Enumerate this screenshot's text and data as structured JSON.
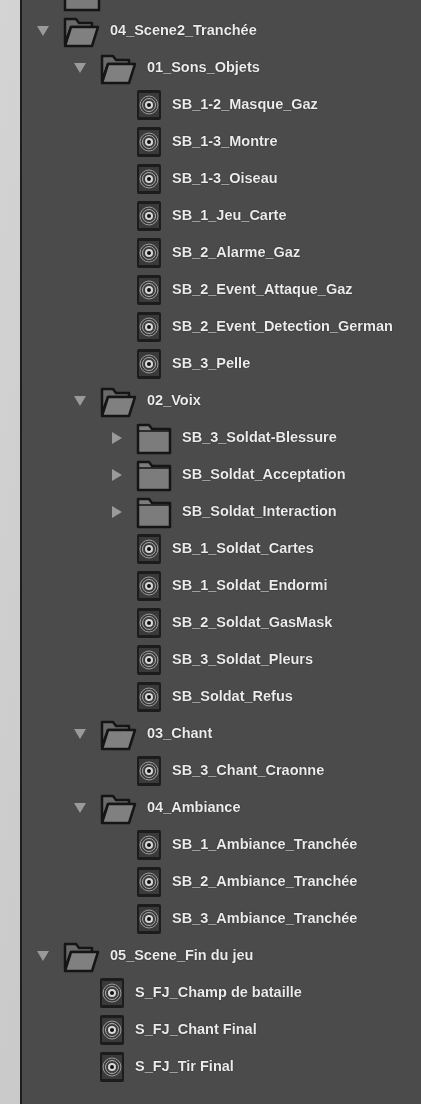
{
  "tree": [
    {
      "kind": "folder",
      "label": "04_Scene2_Tranchée",
      "expanded": true,
      "children": [
        {
          "kind": "folder",
          "label": "01_Sons_Objets",
          "expanded": true,
          "children": [
            {
              "kind": "sound",
              "label": "SB_1-2_Masque_Gaz"
            },
            {
              "kind": "sound",
              "label": "SB_1-3_Montre"
            },
            {
              "kind": "sound",
              "label": "SB_1-3_Oiseau"
            },
            {
              "kind": "sound",
              "label": "SB_1_Jeu_Carte"
            },
            {
              "kind": "sound",
              "label": "SB_2_Alarme_Gaz"
            },
            {
              "kind": "sound",
              "label": "SB_2_Event_Attaque_Gaz"
            },
            {
              "kind": "sound",
              "label": "SB_2_Event_Detection_German"
            },
            {
              "kind": "sound",
              "label": "SB_3_Pelle"
            }
          ]
        },
        {
          "kind": "folder",
          "label": "02_Voix",
          "expanded": true,
          "children": [
            {
              "kind": "folder",
              "label": "SB_3_Soldat-Blessure",
              "expanded": false
            },
            {
              "kind": "folder",
              "label": "SB_Soldat_Acceptation",
              "expanded": false
            },
            {
              "kind": "folder",
              "label": "SB_Soldat_Interaction",
              "expanded": false
            },
            {
              "kind": "sound",
              "label": "SB_1_Soldat_Cartes"
            },
            {
              "kind": "sound",
              "label": "SB_1_Soldat_Endormi"
            },
            {
              "kind": "sound",
              "label": "SB_2_Soldat_GasMask"
            },
            {
              "kind": "sound",
              "label": "SB_3_Soldat_Pleurs"
            },
            {
              "kind": "sound",
              "label": "SB_Soldat_Refus"
            }
          ]
        },
        {
          "kind": "folder",
          "label": "03_Chant",
          "expanded": true,
          "children": [
            {
              "kind": "sound",
              "label": "SB_3_Chant_Craonne"
            }
          ]
        },
        {
          "kind": "folder",
          "label": "04_Ambiance",
          "expanded": true,
          "children": [
            {
              "kind": "sound",
              "label": "SB_1_Ambiance_Tranchée"
            },
            {
              "kind": "sound",
              "label": "SB_2_Ambiance_Tranchée"
            },
            {
              "kind": "sound",
              "label": "SB_3_Ambiance_Tranchée"
            }
          ]
        }
      ]
    },
    {
      "kind": "folder",
      "label": "05_Scene_Fin du jeu",
      "expanded": true,
      "children": [
        {
          "kind": "sound",
          "label": "S_FJ_Champ de bataille"
        },
        {
          "kind": "sound",
          "label": "S_FJ_Chant Final"
        },
        {
          "kind": "sound",
          "label": "S_FJ_Tir Final"
        }
      ]
    }
  ]
}
